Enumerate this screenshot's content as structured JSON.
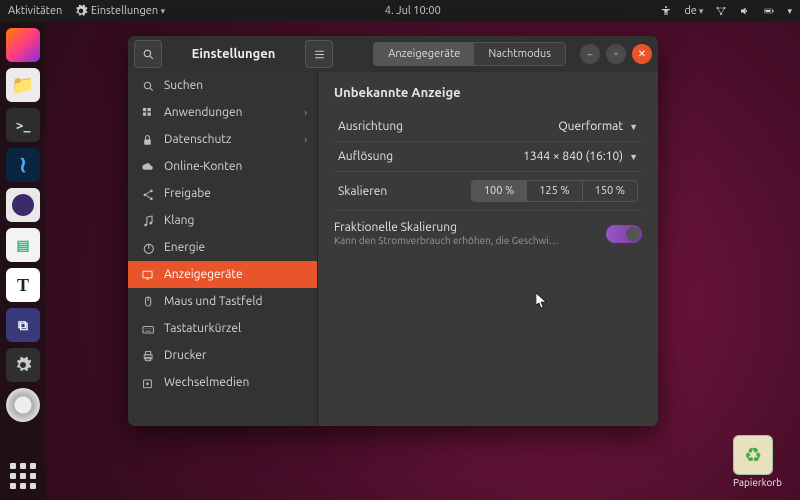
{
  "topbar": {
    "activities": "Aktivitäten",
    "app_menu": "Einstellungen",
    "clock": "4. Jul  10:00",
    "lang": "de"
  },
  "window": {
    "title": "Einstellungen",
    "tabs": {
      "displays": "Anzeigegeräte",
      "night": "Nachtmodus"
    }
  },
  "sidebar": {
    "items": [
      {
        "icon": "search",
        "label": "Suchen"
      },
      {
        "icon": "apps",
        "label": "Anwendungen",
        "chev": true
      },
      {
        "icon": "lock",
        "label": "Datenschutz",
        "chev": true
      },
      {
        "icon": "cloud",
        "label": "Online-Konten"
      },
      {
        "icon": "share",
        "label": "Freigabe"
      },
      {
        "icon": "music",
        "label": "Klang"
      },
      {
        "icon": "power",
        "label": "Energie"
      },
      {
        "icon": "display",
        "label": "Anzeigegeräte",
        "active": true
      },
      {
        "icon": "mouse",
        "label": "Maus und Tastfeld"
      },
      {
        "icon": "keyboard",
        "label": "Tastaturkürzel"
      },
      {
        "icon": "printer",
        "label": "Drucker"
      },
      {
        "icon": "media",
        "label": "Wechselmedien"
      }
    ]
  },
  "pane": {
    "heading": "Unbekannte Anzeige",
    "orientation": {
      "label": "Ausrichtung",
      "value": "Querformat"
    },
    "resolution": {
      "label": "Auflösung",
      "value": "1344 × 840 (16:10)"
    },
    "scale": {
      "label": "Skalieren",
      "options": [
        "100 %",
        "125 %",
        "150 %"
      ],
      "selected": 0
    },
    "fractional": {
      "title": "Fraktionelle Skalierung",
      "desc": "Kann den Stromverbrauch erhöhen, die Geschwindigkeit …",
      "on": true
    }
  },
  "desktop": {
    "trash": "Papierkorb"
  }
}
